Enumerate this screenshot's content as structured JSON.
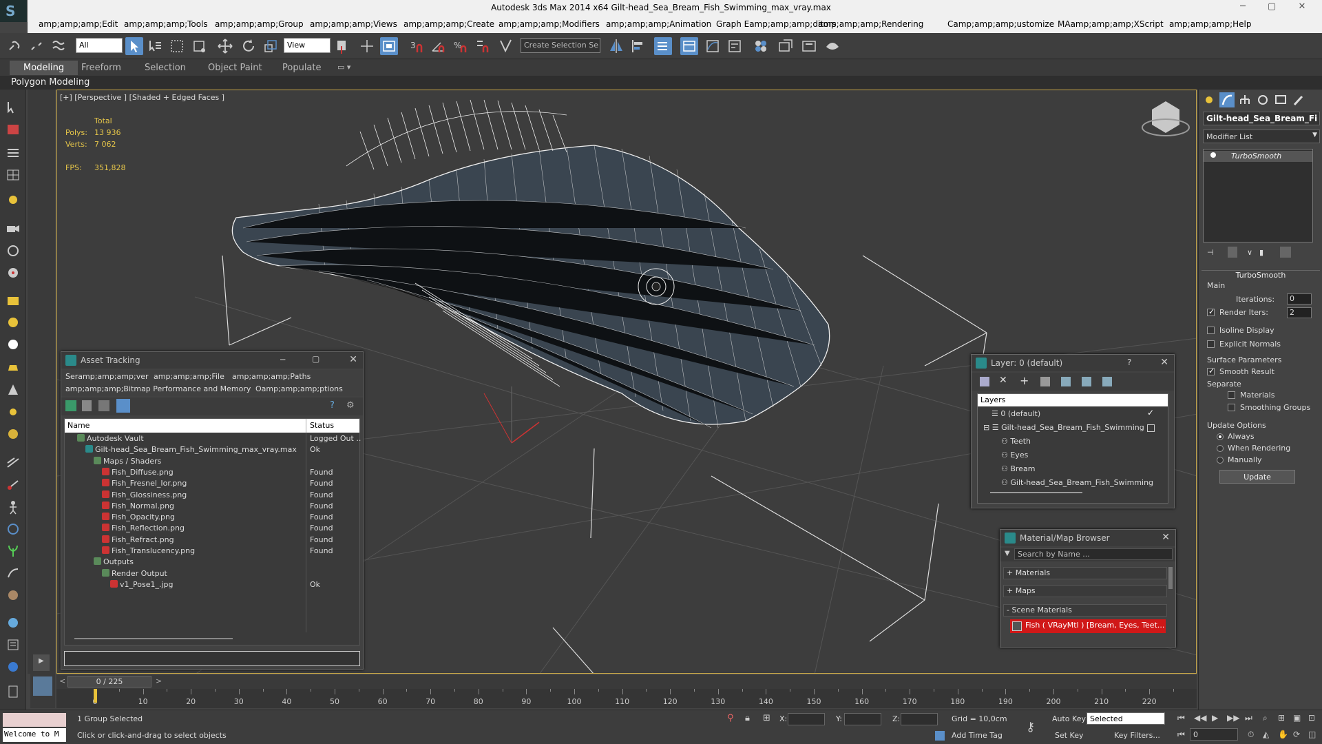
{
  "window": {
    "title": "Autodesk 3ds Max  2014 x64    Gilt-head_Sea_Bream_Fish_Swimming_max_vray.max"
  },
  "menu": [
    "amp;amp;amp;Edit",
    "amp;amp;amp;Tools",
    "amp;amp;amp;Group",
    "amp;amp;amp;Views",
    "amp;amp;amp;Create",
    "amp;amp;amp;Modifiers",
    "amp;amp;amp;Animation",
    "Graph Eamp;amp;amp;ditors",
    "amp;amp;amp;Rendering",
    "Camp;amp;amp;ustomize",
    "MAamp;amp;amp;XScript",
    "amp;amp;amp;Help"
  ],
  "toolbar": {
    "filter_value": "All",
    "refcoord_value": "View",
    "selection_set_placeholder": "Create Selection Se"
  },
  "ribbon": {
    "tabs": [
      "Modeling",
      "Freeform",
      "Selection",
      "Object Paint",
      "Populate"
    ],
    "active": "Modeling",
    "sub": "Polygon Modeling"
  },
  "viewport": {
    "label": "[+] [Perspective ] [Shaded + Edged Faces ]",
    "stats": {
      "total_label": "Total",
      "polys_label": "Polys:",
      "polys": "13 936",
      "verts_label": "Verts:",
      "verts": "7 062",
      "fps_label": "FPS:",
      "fps": "351,828"
    }
  },
  "asset_tracking": {
    "title": "Asset Tracking",
    "menu": [
      "Seramp;amp;amp;ver",
      "amp;amp;amp;File",
      "amp;amp;amp;Paths",
      "amp;amp;amp;Bitmap Performance and Memory",
      "Oamp;amp;amp;ptions"
    ],
    "columns": [
      "Name",
      "Status"
    ],
    "rows": [
      {
        "name": "Autodesk Vault",
        "status": "Logged Out ..",
        "indent": 1
      },
      {
        "name": "Gilt-head_Sea_Bream_Fish_Swimming_max_vray.max",
        "status": "Ok",
        "indent": 2
      },
      {
        "name": "Maps / Shaders",
        "status": "",
        "indent": 3
      },
      {
        "name": "Fish_Diffuse.png",
        "status": "Found",
        "indent": 4
      },
      {
        "name": "Fish_Fresnel_Ior.png",
        "status": "Found",
        "indent": 4
      },
      {
        "name": "Fish_Glossiness.png",
        "status": "Found",
        "indent": 4
      },
      {
        "name": "Fish_Normal.png",
        "status": "Found",
        "indent": 4
      },
      {
        "name": "Fish_Opacity.png",
        "status": "Found",
        "indent": 4
      },
      {
        "name": "Fish_Reflection.png",
        "status": "Found",
        "indent": 4
      },
      {
        "name": "Fish_Refract.png",
        "status": "Found",
        "indent": 4
      },
      {
        "name": "Fish_Translucency.png",
        "status": "Found",
        "indent": 4
      },
      {
        "name": "Outputs",
        "status": "",
        "indent": 3
      },
      {
        "name": "Render Output",
        "status": "",
        "indent": 4
      },
      {
        "name": "v1_Pose1_.jpg",
        "status": "Ok",
        "indent": 5
      }
    ]
  },
  "layers": {
    "title": "Layer: 0 (default)",
    "header": "Layers",
    "items": [
      "0 (default)",
      "Gilt-head_Sea_Bream_Fish_Swimming",
      "Teeth",
      "Eyes",
      "Bream",
      "Gilt-head_Sea_Bream_Fish_Swimming"
    ]
  },
  "material_browser": {
    "title": "Material/Map Browser",
    "search_placeholder": "Search by Name ...",
    "sections": [
      "+ Materials",
      "+ Maps",
      "- Scene Materials"
    ],
    "scene_material": "Fish  ( VRayMtl )  [Bream, Eyes, Teet..."
  },
  "command_panel": {
    "object_name": "Gilt-head_Sea_Bream_Fi",
    "modifier_list": "Modifier List",
    "stack_item": "TurboSmooth",
    "rollout": "TurboSmooth",
    "main": "Main",
    "iterations_label": "Iterations:",
    "iterations": "0",
    "render_iters_label": "Render Iters:",
    "render_iters": "2",
    "isoline": "Isoline Display",
    "explicit_normals": "Explicit Normals",
    "surface_params": "Surface Parameters",
    "smooth_result": "Smooth Result",
    "separate": "Separate",
    "materials": "Materials",
    "smoothing_groups": "Smoothing Groups",
    "update_options": "Update Options",
    "always": "Always",
    "when_rendering": "When Rendering",
    "manually": "Manually",
    "update_btn": "Update"
  },
  "timeline": {
    "frame": "0 / 225",
    "ticks": [
      "0",
      "10",
      "20",
      "30",
      "40",
      "50",
      "60",
      "70",
      "80",
      "90",
      "100",
      "110",
      "120",
      "130",
      "140",
      "150",
      "160",
      "170",
      "180",
      "190",
      "200",
      "210",
      "220"
    ]
  },
  "status": {
    "welcome": "Welcome to M",
    "selected": "1 Group Selected",
    "prompt": "Click or click-and-drag to select objects",
    "x_label": "X:",
    "y_label": "Y:",
    "z_label": "Z:",
    "grid": "Grid = 10,0cm",
    "add_time_tag": "Add Time Tag",
    "auto_key": "Auto Key",
    "set_key": "Set Key",
    "key_mode": "Selected",
    "key_filters": "Key Filters...",
    "frame_field": "0"
  },
  "colors": {
    "accent": "#5a8fc9",
    "viewport_border": "#c8a84a",
    "stats": "#e6c64a",
    "material_red": "#d01818"
  }
}
